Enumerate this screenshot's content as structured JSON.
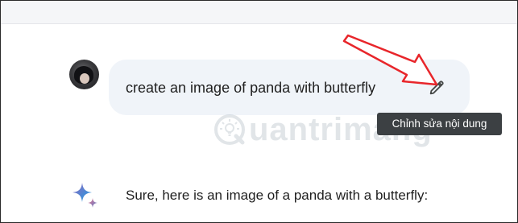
{
  "conversation": {
    "user_prompt": "create an image of panda with butterfly",
    "edit_tooltip": "Chỉnh sửa nội dung",
    "response_text": "Sure, here is an image of a panda with a butterfly:"
  },
  "watermark": {
    "text": "uantrimang"
  },
  "icons": {
    "edit": "pencil-icon",
    "assistant": "gemini-sparkle-icon",
    "annotation": "red-arrow"
  },
  "colors": {
    "bubble_bg": "#f0f4f9",
    "tooltip_bg": "#3c4043",
    "arrow_red": "#e8262b",
    "text": "#1f1f1f"
  }
}
